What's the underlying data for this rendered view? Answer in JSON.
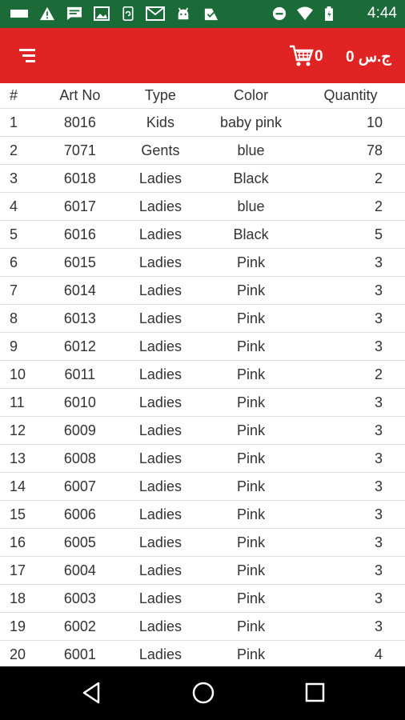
{
  "status_bar": {
    "time": "4:44",
    "left_icons": [
      "message-icon",
      "warning-icon",
      "chat-icon",
      "image-icon",
      "sync-icon",
      "gmail-icon",
      "android-icon",
      "check-icon"
    ],
    "right_icons": [
      "do-not-disturb-icon",
      "wifi-icon",
      "battery-icon"
    ]
  },
  "app_bar": {
    "menu_icon": "menu-sort-icon",
    "cart_icon": "shopping-cart-icon",
    "cart_count": "0",
    "currency_value": "0 ج.س",
    "accent_color": "#e02424"
  },
  "table": {
    "headers": [
      "#",
      "Art No",
      "Type",
      "Color",
      "Quantity"
    ],
    "rows": [
      [
        "1",
        "8016",
        "Kids",
        "baby pink",
        "10"
      ],
      [
        "2",
        "7071",
        "Gents",
        "blue",
        "78"
      ],
      [
        "3",
        "6018",
        "Ladies",
        "Black",
        "2"
      ],
      [
        "4",
        "6017",
        "Ladies",
        "blue",
        "2"
      ],
      [
        "5",
        "6016",
        "Ladies",
        "Black",
        "5"
      ],
      [
        "6",
        "6015",
        "Ladies",
        "Pink",
        "3"
      ],
      [
        "7",
        "6014",
        "Ladies",
        "Pink",
        "3"
      ],
      [
        "8",
        "6013",
        "Ladies",
        "Pink",
        "3"
      ],
      [
        "9",
        "6012",
        "Ladies",
        "Pink",
        "3"
      ],
      [
        "10",
        "6011",
        "Ladies",
        "Pink",
        "2"
      ],
      [
        "11",
        "6010",
        "Ladies",
        "Pink",
        "3"
      ],
      [
        "12",
        "6009",
        "Ladies",
        "Pink",
        "3"
      ],
      [
        "13",
        "6008",
        "Ladies",
        "Pink",
        "3"
      ],
      [
        "14",
        "6007",
        "Ladies",
        "Pink",
        "3"
      ],
      [
        "15",
        "6006",
        "Ladies",
        "Pink",
        "3"
      ],
      [
        "16",
        "6005",
        "Ladies",
        "Pink",
        "3"
      ],
      [
        "17",
        "6004",
        "Ladies",
        "Pink",
        "3"
      ],
      [
        "18",
        "6003",
        "Ladies",
        "Pink",
        "3"
      ],
      [
        "19",
        "6002",
        "Ladies",
        "Pink",
        "3"
      ],
      [
        "20",
        "6001",
        "Ladies",
        "Pink",
        "4"
      ]
    ]
  },
  "nav_bar": {
    "buttons": [
      "back-icon",
      "home-icon",
      "recents-icon"
    ]
  }
}
